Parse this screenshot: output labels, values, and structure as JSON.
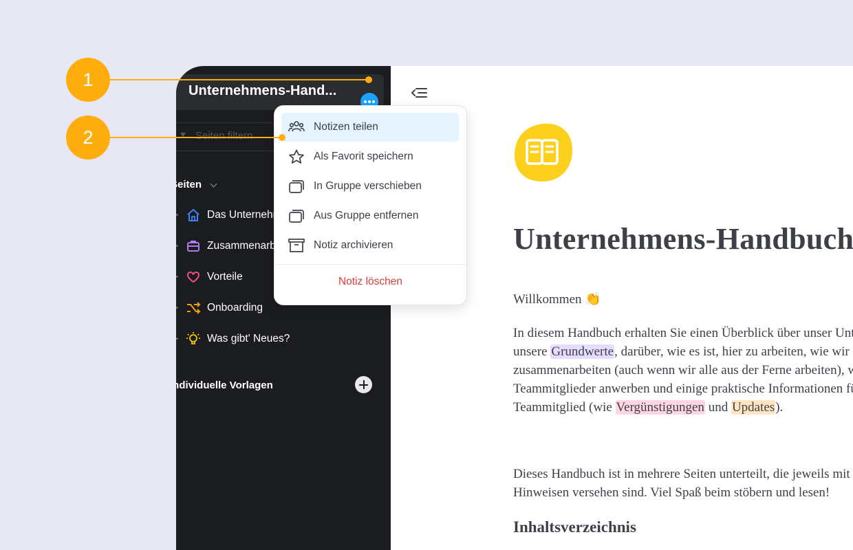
{
  "sidebar": {
    "workspace_title": "Unternehmens-Hand...",
    "filter_placeholder": "Seiten filtern",
    "pages_label": "Seiten",
    "items": [
      {
        "label": "Das Unternehmen",
        "icon": "home-icon"
      },
      {
        "label": "Zusammenarbeit",
        "icon": "briefcase-icon"
      },
      {
        "label": "Vorteile",
        "icon": "heart-icon"
      },
      {
        "label": "Onboarding",
        "icon": "shuffle-icon"
      },
      {
        "label": "Was gibt' Neues?",
        "icon": "lightbulb-icon"
      }
    ],
    "templates_label": "Individuelle Vorlagen"
  },
  "menu": {
    "items": [
      {
        "label": "Notizen teilen",
        "icon": "people-icon"
      },
      {
        "label": "Als Favorit speichern",
        "icon": "star-icon"
      },
      {
        "label": "In Gruppe verschieben",
        "icon": "group-icon"
      },
      {
        "label": "Aus Gruppe entfernen",
        "icon": "group-icon"
      },
      {
        "label": "Notiz archivieren",
        "icon": "archive-icon"
      }
    ],
    "delete_label": "Notiz löschen"
  },
  "document": {
    "title": "Unternehmens-Handbuch",
    "welcome": "Willkommen 👏",
    "intro": {
      "l1": "In diesem Handbuch erhalten Sie einen Überblick über unser Unternehmen,",
      "l2a": "unsere ",
      "hl1": "Grundwerte",
      "l2b": ", darüber, wie es ist, hier zu arbeiten, wie wir",
      "l3": "zusammenarbeiten (auch wenn wir alle aus der Ferne arbeiten), wie wir neue",
      "l4": "Teammitglieder anwerben und einige praktische Informationen für jedes",
      "l5a": "Teammitglied (wie ",
      "hl2": "Vergünstigungen",
      "l5b": " und ",
      "hl3": "Updates",
      "l5c": ")."
    },
    "para2_l1": "Dieses Handbuch ist in mehrere Seiten unterteilt, die jeweils mit nützlichen",
    "para2_l2": "Hinweisen versehen sind. Viel Spaß beim stöbern und lesen!",
    "toc_heading": "Inhaltsverzeichnis"
  },
  "callouts": [
    "1",
    "2"
  ],
  "colors": {
    "accent": "#1ba3ff",
    "callout": "#ffad0d",
    "delete": "#d63c3c",
    "sidebar": "#1b1c1f"
  }
}
